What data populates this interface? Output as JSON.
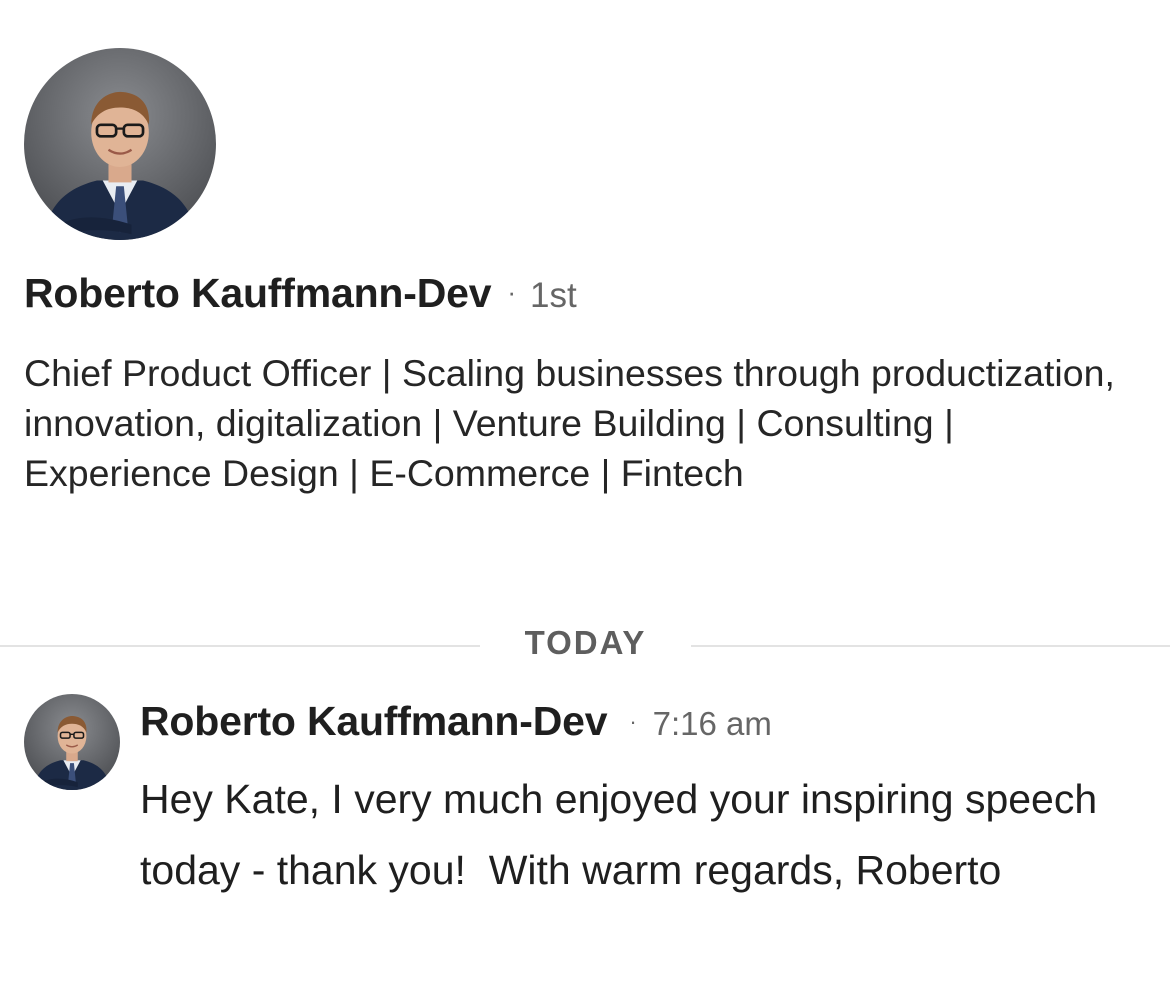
{
  "profile": {
    "name": "Roberto Kauffmann-Dev",
    "separator": "·",
    "degree": "1st",
    "headline": "Chief Product Officer | Scaling businesses through productization, innovation, digitalization | Venture Building | Consulting | Experience Design | E-Commerce | Fintech"
  },
  "divider": {
    "label": "TODAY"
  },
  "message": {
    "sender": "Roberto Kauffmann-Dev",
    "separator": "·",
    "time": "7:16 am",
    "body": "Hey Kate, I very much enjoyed your inspiring speech today - thank you!  With warm regards, Roberto"
  },
  "colors": {
    "text_primary": "#1f1f1f",
    "text_secondary": "#666666",
    "divider": "#e3e3e3",
    "avatar_background": "#5f6166",
    "suit": "#1c2a45"
  }
}
